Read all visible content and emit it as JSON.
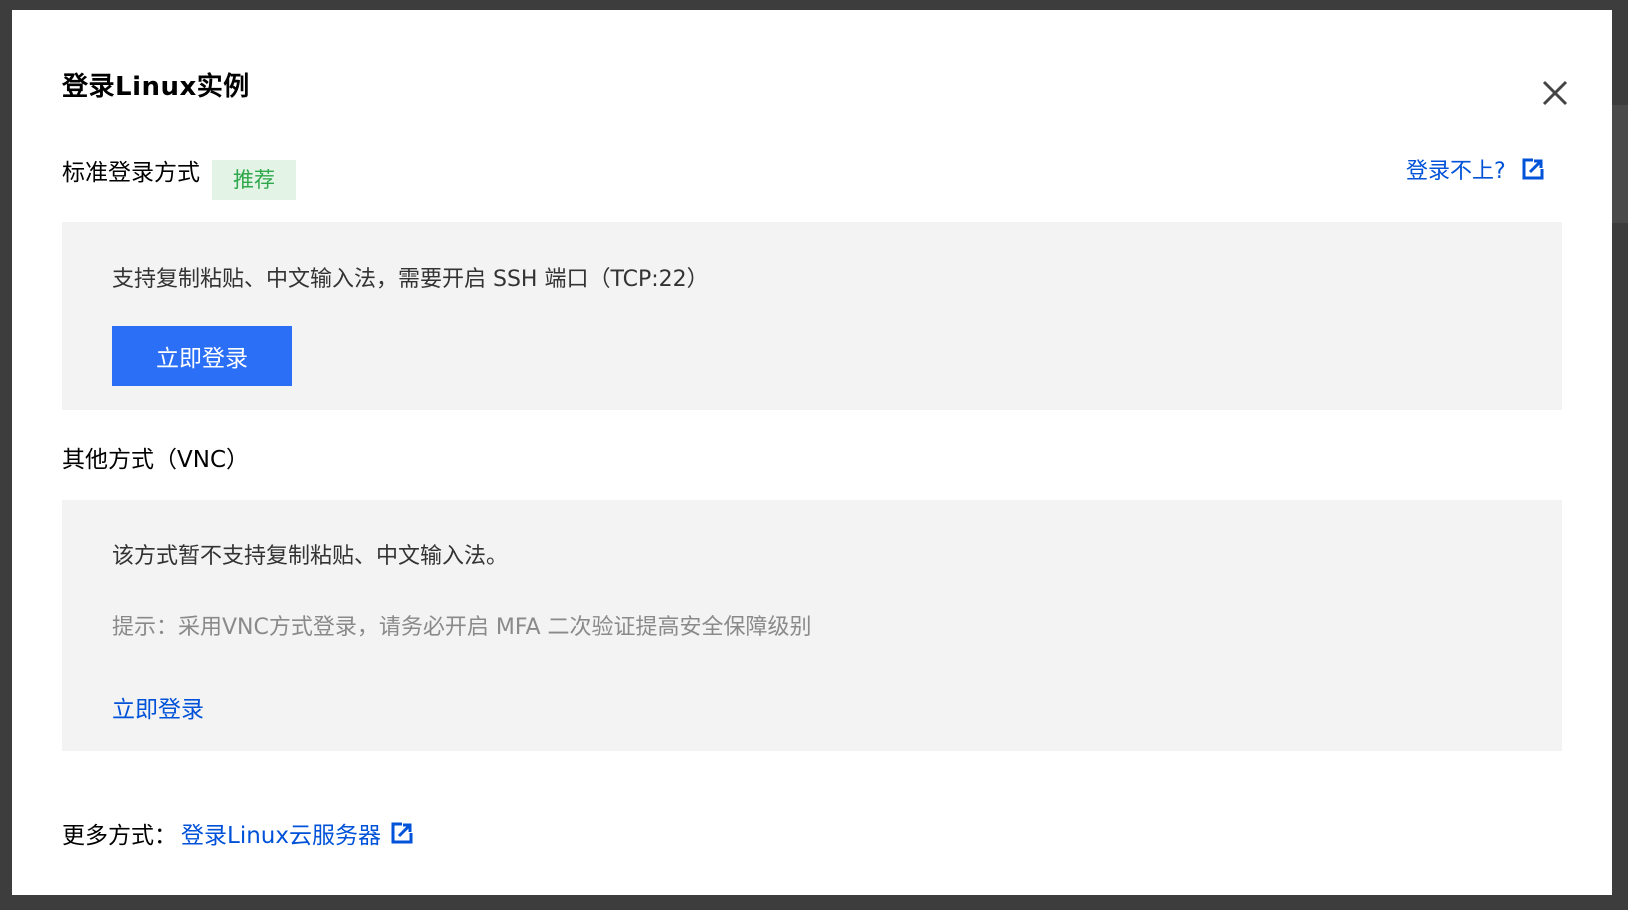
{
  "modal": {
    "title": "登录Linux实例",
    "close_icon": "close-icon"
  },
  "standard": {
    "label": "标准登录方式",
    "badge": "推荐",
    "help_link": "登录不上?",
    "help_icon": "external-link-icon",
    "description": "支持复制粘贴、中文输入法，需要开启 SSH 端口（TCP:22）",
    "login_button": "立即登录",
    "colors": {
      "button": "#2a6ff5",
      "badge_bg": "#e3f4e6",
      "badge_text": "#2ea84a"
    }
  },
  "vnc": {
    "label": "其他方式（VNC）",
    "description": "该方式暂不支持复制粘贴、中文输入法。",
    "hint": "提示：采用VNC方式登录，请务必开启 MFA 二次验证提高安全保障级别",
    "login_link": "立即登录"
  },
  "more": {
    "label": "更多方式：",
    "link": "登录Linux云服务器",
    "link_icon": "external-link-icon",
    "colors": {
      "link": "#0052d9"
    }
  }
}
